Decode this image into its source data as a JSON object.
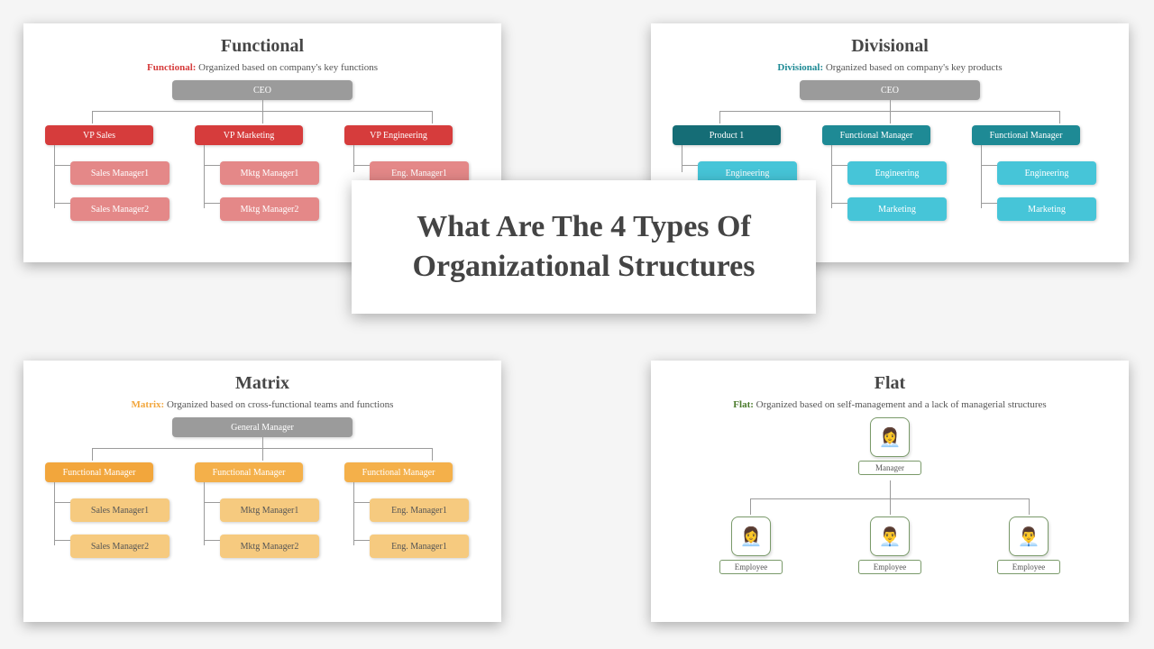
{
  "center_title": "What Are The 4 Types Of Organizational Structures",
  "cards": {
    "functional": {
      "title": "Functional",
      "sub_label": "Functional:",
      "sub_text": "Organized  based on company's key functions",
      "root": "CEO",
      "vps": [
        "VP Sales",
        "VP Marketing",
        "VP Engineering"
      ],
      "leaves": [
        [
          "Sales Manager1",
          "Sales Manager2"
        ],
        [
          "Mktg Manager1",
          "Mktg Manager2"
        ],
        [
          "Eng. Manager1"
        ]
      ]
    },
    "divisional": {
      "title": "Divisional",
      "sub_label": "Divisional:",
      "sub_text": "Organized  based on company's key products",
      "root": "CEO",
      "vps": [
        "Product 1",
        "Functional Manager",
        "Functional Manager"
      ],
      "leaves": [
        [
          "Engineering"
        ],
        [
          "Engineering",
          "Marketing"
        ],
        [
          "Engineering",
          "Marketing"
        ]
      ]
    },
    "matrix": {
      "title": "Matrix",
      "sub_label": "Matrix:",
      "sub_text": "Organized based on cross-functional teams and functions",
      "root": "General Manager",
      "vps": [
        "Functional Manager",
        "Functional Manager",
        "Functional Manager"
      ],
      "leaves": [
        [
          "Sales Manager1",
          "Sales Manager2"
        ],
        [
          "Mktg Manager1",
          "Mktg Manager2"
        ],
        [
          "Eng. Manager1",
          "Eng. Manager1"
        ]
      ]
    },
    "flat": {
      "title": "Flat",
      "sub_label": "Flat:",
      "sub_text": "Organized  based on self-management and a lack of managerial structures",
      "manager": "Manager",
      "employees": [
        "Employee",
        "Employee",
        "Employee"
      ]
    }
  }
}
